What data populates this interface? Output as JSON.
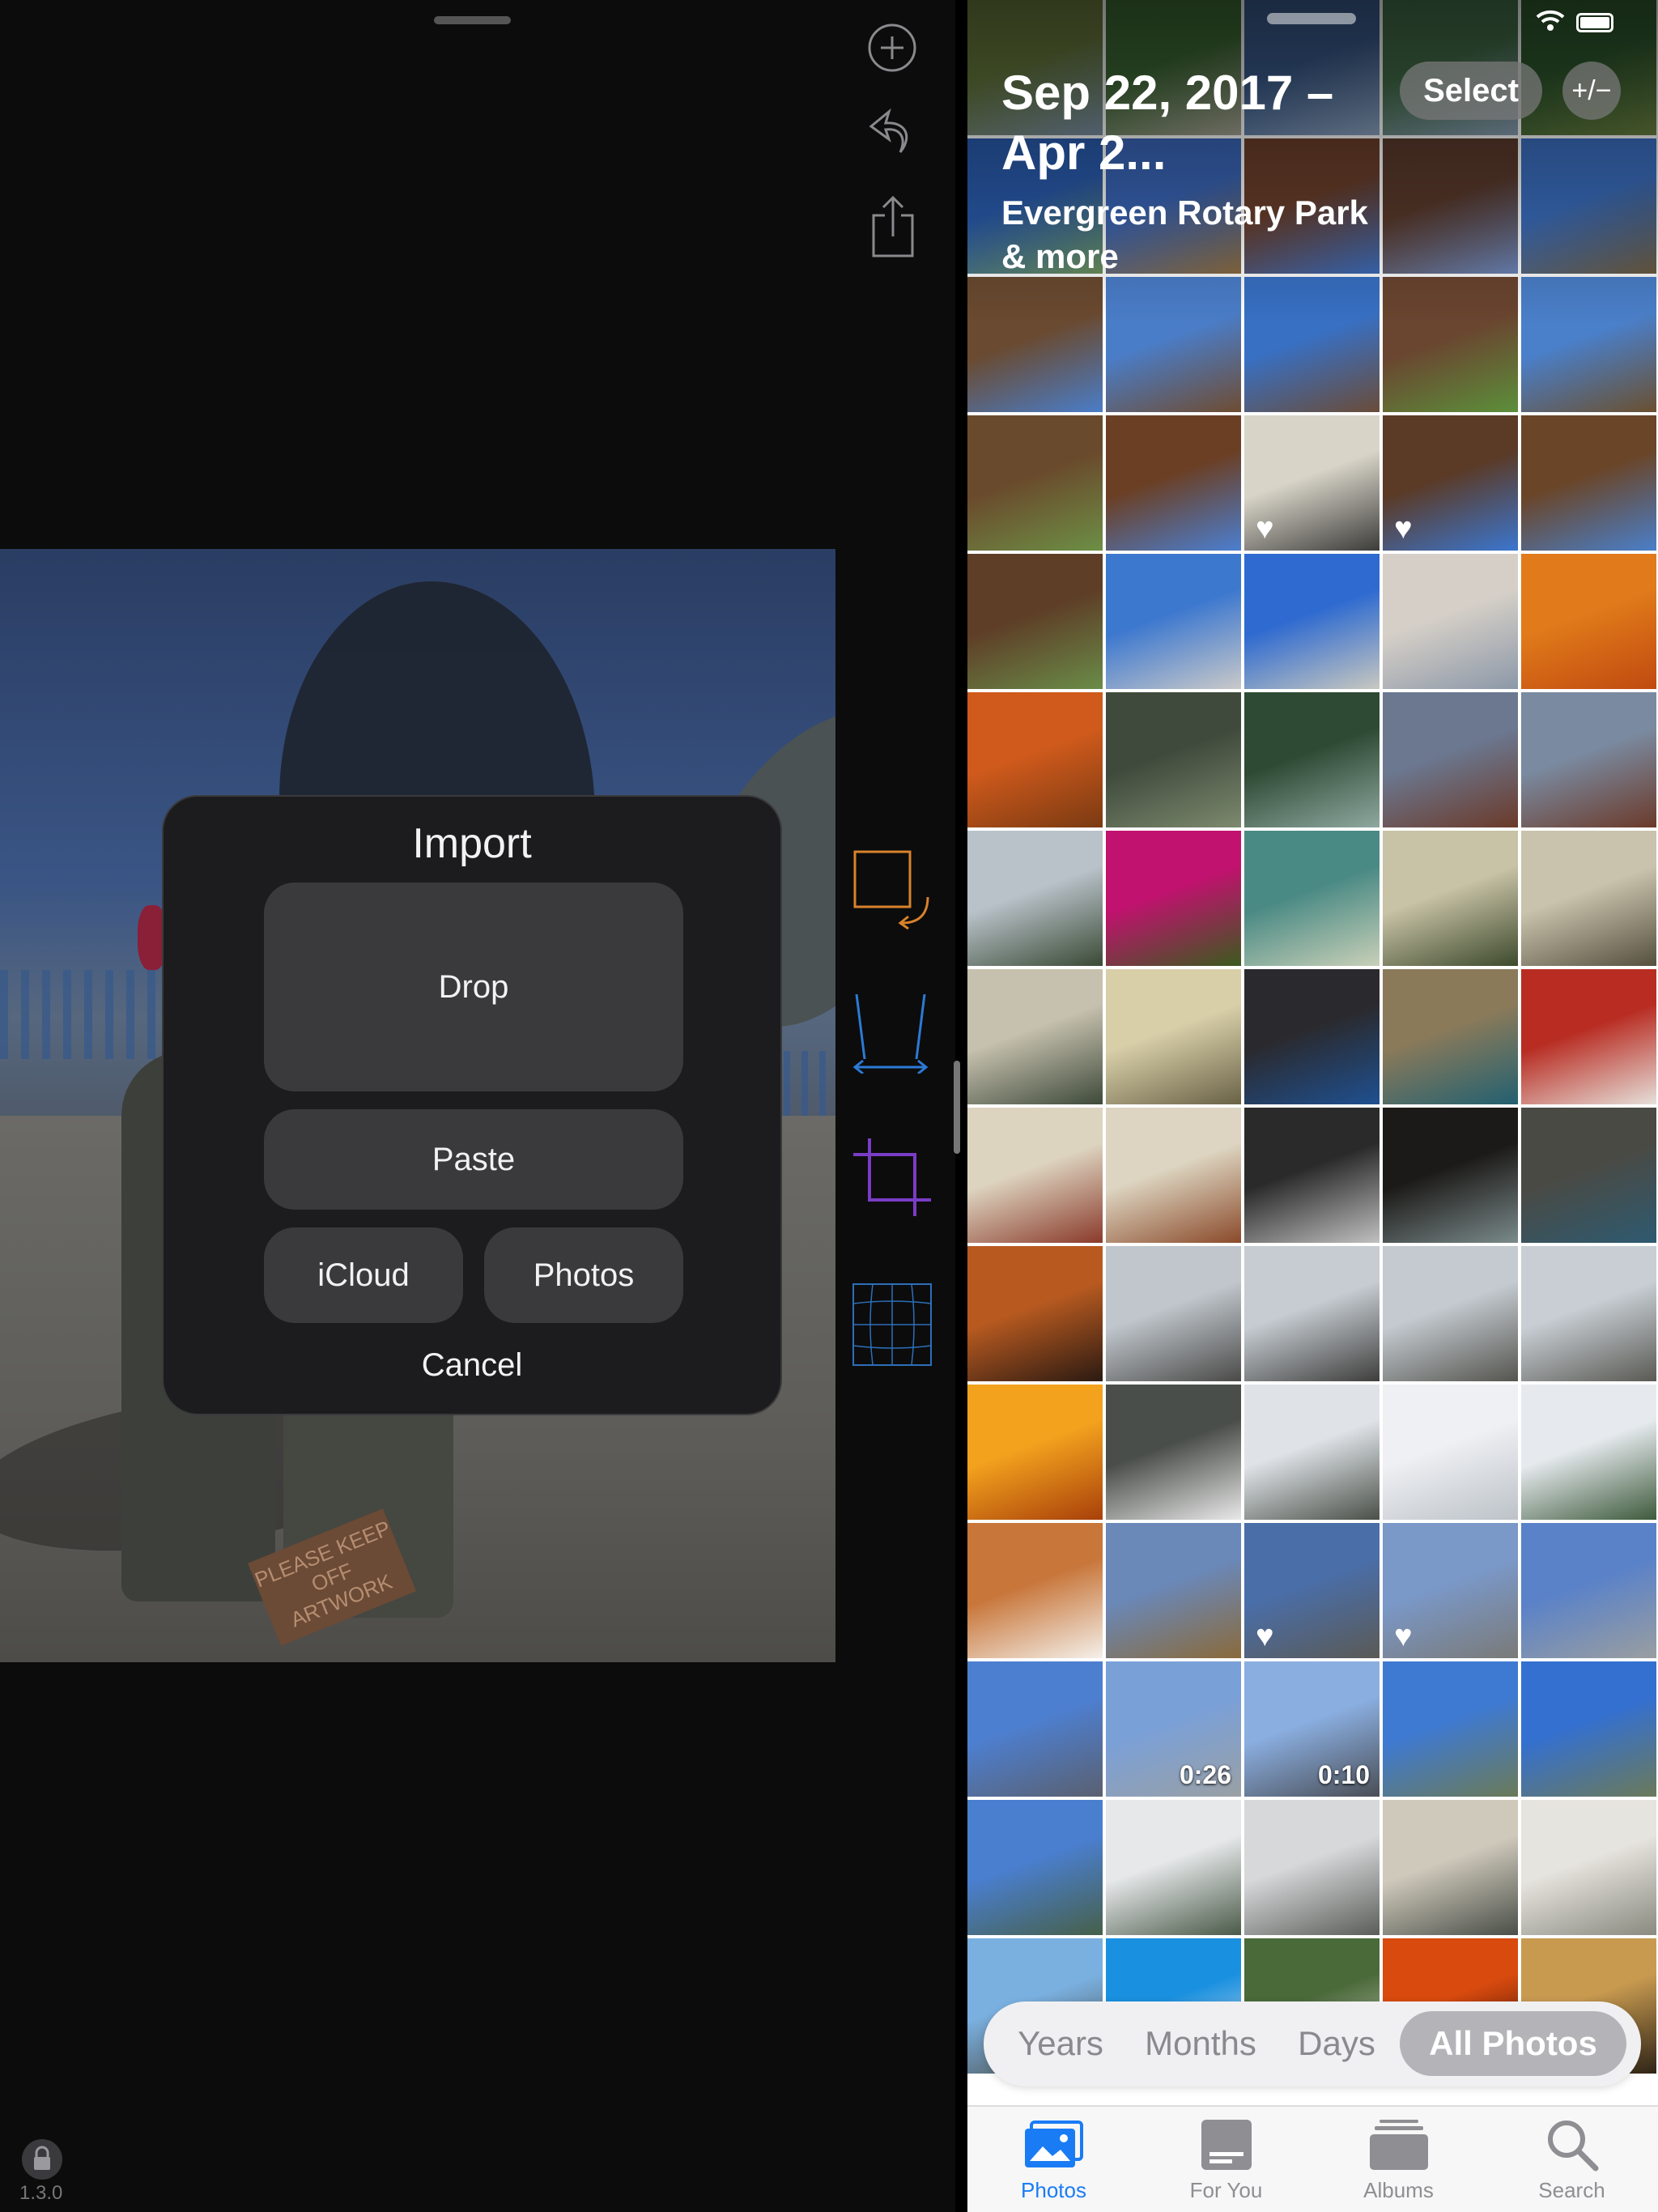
{
  "editor": {
    "version": "1.3.0",
    "toolbar": {
      "add_icon": "plus-circle-icon",
      "undo_icon": "undo-icon",
      "share_icon": "share-icon",
      "rotate_icon": "rotate-icon",
      "perspective_icon": "perspective-icon",
      "crop_icon": "crop-icon",
      "grid_icon": "grid-icon"
    },
    "photo_plaque_text": "PLEASE KEEP OFF ARTWORK"
  },
  "import_dialog": {
    "title": "Import",
    "drop_label": "Drop",
    "paste_label": "Paste",
    "icloud_label": "iCloud",
    "photos_label": "Photos",
    "cancel_label": "Cancel"
  },
  "photos_app": {
    "date_range": "Sep 22, 2017 – Apr 2...",
    "location": "Evergreen Rotary Park & more",
    "select_label": "Select",
    "plus_minus_label": "+/−",
    "tiles": [
      {
        "c1": "#6a7d3e",
        "c2": "#7a8fa6"
      },
      {
        "c1": "#3d6b35",
        "c2": "#a6a395"
      },
      {
        "c1": "#3b5d8f",
        "c2": "#8da4c0"
      },
      {
        "c1": "#44704a",
        "c2": "#8aa0b6"
      },
      {
        "c1": "#2f5a2e",
        "c2": "#6a8140"
      },
      {
        "c1": "#2a5cae",
        "c2": "#6a8f5a"
      },
      {
        "c1": "#3a66b8",
        "c2": "#8a6a3e"
      },
      {
        "c1": "#6b3f2b",
        "c2": "#3a6ab8"
      },
      {
        "c1": "#5a3a2c",
        "c2": "#6a85b8"
      },
      {
        "c1": "#3b6fc0",
        "c2": "#6b5a3e"
      },
      {
        "c1": "#6a4a30",
        "c2": "#4a7dc8"
      },
      {
        "c1": "#4a7dc8",
        "c2": "#6e4c32"
      },
      {
        "c1": "#3870c4",
        "c2": "#6a4c38"
      },
      {
        "c1": "#6a4530",
        "c2": "#5c8f3a"
      },
      {
        "c1": "#4a7fc9",
        "c2": "#6a5030"
      },
      {
        "c1": "#6a4a2c",
        "c2": "#6d8f45"
      },
      {
        "c1": "#6b3f24",
        "c2": "#4b7fd1"
      },
      {
        "c1": "#d8d4c8",
        "c2": "#3c3c3a"
      },
      {
        "c1": "#5b3a26",
        "c2": "#3b76cf"
      },
      {
        "c1": "#6a4528",
        "c2": "#4a7fc9"
      },
      {
        "c1": "#5e3e27",
        "c2": "#6a8c48"
      },
      {
        "c1": "#3d78cf",
        "c2": "#c9c9c9"
      },
      {
        "c1": "#2e6ad0",
        "c2": "#c8c8c0"
      },
      {
        "c1": "#d5cfc7",
        "c2": "#8c98a8"
      },
      {
        "c1": "#e07a1a",
        "c2": "#c04a10"
      },
      {
        "c1": "#d05a1c",
        "c2": "#7a3a12"
      },
      {
        "c1": "#3f4a3c",
        "c2": "#7c8a6e"
      },
      {
        "c1": "#2e4a34",
        "c2": "#8fa8a0"
      },
      {
        "c1": "#6b7890",
        "c2": "#6b3a2a"
      },
      {
        "c1": "#7a8aa0",
        "c2": "#6b3a2a"
      },
      {
        "c1": "#b9c2c9",
        "c2": "#3a4a35"
      },
      {
        "c1": "#c0126e",
        "c2": "#3b5a1e"
      },
      {
        "c1": "#4a8a84",
        "c2": "#c8d0b8"
      },
      {
        "c1": "#c8c2a6",
        "c2": "#3d4a2c"
      },
      {
        "c1": "#c9c3ad",
        "c2": "#55503e"
      },
      {
        "c1": "#c6c0ae",
        "c2": "#3e4a3a"
      },
      {
        "c1": "#d8cfa9",
        "c2": "#6a6246"
      },
      {
        "c1": "#2a2a2e",
        "c2": "#1f5090"
      },
      {
        "c1": "#8a7a5a",
        "c2": "#226070"
      },
      {
        "c1": "#b82c22",
        "c2": "#e6e0da"
      },
      {
        "c1": "#ddd4c0",
        "c2": "#8a3a2a"
      },
      {
        "c1": "#ddd5c1",
        "c2": "#8a4a2a"
      },
      {
        "c1": "#2a2a2a",
        "c2": "#c0c0c0"
      },
      {
        "c1": "#1c1a18",
        "c2": "#7a8a8a"
      },
      {
        "c1": "#4a4a44",
        "c2": "#2e5a70"
      },
      {
        "c1": "#b85a20",
        "c2": "#2b1a12"
      },
      {
        "c1": "#c0c6cc",
        "c2": "#4a4a48"
      },
      {
        "c1": "#c6ccd2",
        "c2": "#3e3e3c"
      },
      {
        "c1": "#c4cad0",
        "c2": "#55554f"
      },
      {
        "c1": "#c8ced4",
        "c2": "#5a5a54"
      },
      {
        "c1": "#f3a21e",
        "c2": "#a8400a"
      },
      {
        "c1": "#4a4e4a",
        "c2": "#e8e8e8"
      },
      {
        "c1": "#dfe3e8",
        "c2": "#4a5048"
      },
      {
        "c1": "#eef0f3",
        "c2": "#bcc2c8"
      },
      {
        "c1": "#e6eaee",
        "c2": "#3e5a3c"
      },
      {
        "c1": "#c8763a",
        "c2": "#f4f0ea"
      },
      {
        "c1": "#6a88b8",
        "c2": "#8a6a3a"
      },
      {
        "c1": "#4a6ea8",
        "c2": "#5a5a56"
      },
      {
        "c1": "#7a98c8",
        "c2": "#7a7a78"
      },
      {
        "c1": "#5a82c8",
        "c2": "#9a9ea0"
      },
      {
        "c1": "#4d7fd0",
        "c2": "#5a6070"
      },
      {
        "c1": "#7aa0d8",
        "c2": "#9aa0a4"
      },
      {
        "c1": "#8aaee0",
        "c2": "#4a4e56"
      },
      {
        "c1": "#3f7ad2",
        "c2": "#6a7a58"
      },
      {
        "c1": "#3470d0",
        "c2": "#6b7a5a"
      },
      {
        "c1": "#4a7fd0",
        "c2": "#46604a"
      },
      {
        "c1": "#e6e8ea",
        "c2": "#4a5a48"
      },
      {
        "c1": "#d6d8da",
        "c2": "#5a5e58"
      },
      {
        "c1": "#cfc9bb",
        "c2": "#4a4f48"
      },
      {
        "c1": "#e6e4de",
        "c2": "#8a8a80"
      },
      {
        "c1": "#7ab0e0",
        "c2": "#4a4a44"
      },
      {
        "c1": "#1a90e0",
        "c2": "#e8e8e8"
      },
      {
        "c1": "#4a6a3a",
        "c2": "#d6d0c4"
      },
      {
        "c1": "#d84a0e",
        "c2": "#2a0a06"
      },
      {
        "c1": "#c89a50",
        "c2": "#2e2416"
      }
    ],
    "heart_tiles": [
      17,
      18,
      57,
      58
    ],
    "durations": [
      {
        "tile": 61,
        "text": "0:26"
      },
      {
        "tile": 62,
        "text": "0:10"
      }
    ],
    "segments": {
      "years": "Years",
      "months": "Months",
      "days": "Days",
      "all_photos": "All Photos"
    },
    "tabs": {
      "photos": "Photos",
      "for_you": "For You",
      "albums": "Albums",
      "search": "Search"
    },
    "accent_color": "#1a7cf5"
  }
}
